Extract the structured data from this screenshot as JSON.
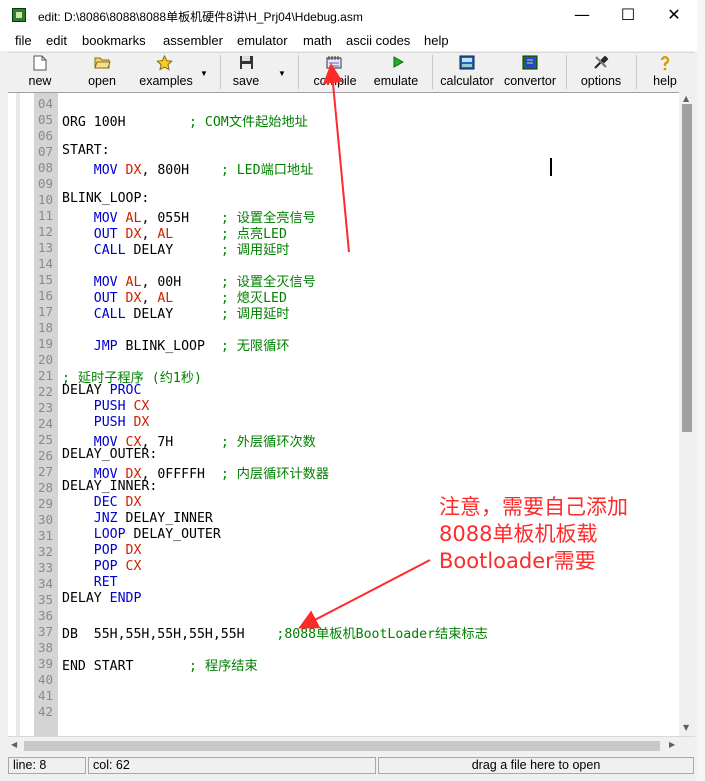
{
  "window": {
    "title": "edit: D:\\8086\\8088\\8088单板机硬件8讲\\H_Prj04\\Hdebug.asm",
    "controls": [
      "—",
      "☐",
      "✕"
    ]
  },
  "menu": [
    "file",
    "edit",
    "bookmarks",
    "assembler",
    "emulator",
    "math",
    "ascii codes",
    "help"
  ],
  "toolbar": {
    "new": "new",
    "open": "open",
    "examples": "examples",
    "save": "save",
    "compile": "compile",
    "emulate": "emulate",
    "calculator": "calculator",
    "convertor": "convertor",
    "options": "options",
    "help": "help"
  },
  "lines": [
    {
      "n": "04",
      "t": []
    },
    {
      "n": "05",
      "t": [
        [
          "ORG 100H        ",
          "p"
        ],
        [
          "; COM文件起始地址",
          "c"
        ]
      ]
    },
    {
      "n": "06",
      "t": []
    },
    {
      "n": "07",
      "t": [
        [
          "START:",
          "p"
        ]
      ]
    },
    {
      "n": "08",
      "t": [
        [
          "    ",
          "p"
        ],
        [
          "MOV",
          "k"
        ],
        [
          " ",
          "p"
        ],
        [
          "DX",
          "r"
        ],
        [
          ", 800H    ",
          "p"
        ],
        [
          "; LED端口地址",
          "c"
        ]
      ]
    },
    {
      "n": "09",
      "t": []
    },
    {
      "n": "10",
      "t": [
        [
          "BLINK_LOOP:",
          "p"
        ]
      ]
    },
    {
      "n": "11",
      "t": [
        [
          "    ",
          "p"
        ],
        [
          "MOV",
          "k"
        ],
        [
          " ",
          "p"
        ],
        [
          "AL",
          "r"
        ],
        [
          ", 055H    ",
          "p"
        ],
        [
          "; 设置全亮信号",
          "c"
        ]
      ]
    },
    {
      "n": "12",
      "t": [
        [
          "    ",
          "p"
        ],
        [
          "OUT",
          "k"
        ],
        [
          " ",
          "p"
        ],
        [
          "DX",
          "r"
        ],
        [
          ", ",
          "p"
        ],
        [
          "AL",
          "r"
        ],
        [
          "      ",
          "p"
        ],
        [
          "; 点亮LED",
          "c"
        ]
      ]
    },
    {
      "n": "13",
      "t": [
        [
          "    ",
          "p"
        ],
        [
          "CALL",
          "k"
        ],
        [
          " DELAY      ",
          "p"
        ],
        [
          "; 调用延时",
          "c"
        ]
      ]
    },
    {
      "n": "14",
      "t": []
    },
    {
      "n": "15",
      "t": [
        [
          "    ",
          "p"
        ],
        [
          "MOV",
          "k"
        ],
        [
          " ",
          "p"
        ],
        [
          "AL",
          "r"
        ],
        [
          ", 00H     ",
          "p"
        ],
        [
          "; 设置全灭信号",
          "c"
        ]
      ]
    },
    {
      "n": "16",
      "t": [
        [
          "    ",
          "p"
        ],
        [
          "OUT",
          "k"
        ],
        [
          " ",
          "p"
        ],
        [
          "DX",
          "r"
        ],
        [
          ", ",
          "p"
        ],
        [
          "AL",
          "r"
        ],
        [
          "      ",
          "p"
        ],
        [
          "; 熄灭LED",
          "c"
        ]
      ]
    },
    {
      "n": "17",
      "t": [
        [
          "    ",
          "p"
        ],
        [
          "CALL",
          "k"
        ],
        [
          " DELAY      ",
          "p"
        ],
        [
          "; 调用延时",
          "c"
        ]
      ]
    },
    {
      "n": "18",
      "t": []
    },
    {
      "n": "19",
      "t": [
        [
          "    ",
          "p"
        ],
        [
          "JMP",
          "k"
        ],
        [
          " BLINK_LOOP  ",
          "p"
        ],
        [
          "; 无限循环",
          "c"
        ]
      ]
    },
    {
      "n": "20",
      "t": []
    },
    {
      "n": "21",
      "t": [
        [
          "; 延时子程序 (约1秒)",
          "c"
        ]
      ]
    },
    {
      "n": "22",
      "t": [
        [
          "DELAY ",
          "p"
        ],
        [
          "PROC",
          "k"
        ]
      ]
    },
    {
      "n": "23",
      "t": [
        [
          "    ",
          "p"
        ],
        [
          "PUSH",
          "k"
        ],
        [
          " ",
          "p"
        ],
        [
          "CX",
          "r"
        ]
      ]
    },
    {
      "n": "24",
      "t": [
        [
          "    ",
          "p"
        ],
        [
          "PUSH",
          "k"
        ],
        [
          " ",
          "p"
        ],
        [
          "DX",
          "r"
        ]
      ]
    },
    {
      "n": "25",
      "t": [
        [
          "    ",
          "p"
        ],
        [
          "MOV",
          "k"
        ],
        [
          " ",
          "p"
        ],
        [
          "CX",
          "r"
        ],
        [
          ", 7H      ",
          "p"
        ],
        [
          "; 外层循环次数",
          "c"
        ]
      ]
    },
    {
      "n": "26",
      "t": [
        [
          "DELAY_OUTER:",
          "p"
        ]
      ]
    },
    {
      "n": "27",
      "t": [
        [
          "    ",
          "p"
        ],
        [
          "MOV",
          "k"
        ],
        [
          " ",
          "p"
        ],
        [
          "DX",
          "r"
        ],
        [
          ", 0FFFFH  ",
          "p"
        ],
        [
          "; 内层循环计数器",
          "c"
        ]
      ]
    },
    {
      "n": "28",
      "t": [
        [
          "DELAY_INNER:",
          "p"
        ]
      ]
    },
    {
      "n": "29",
      "t": [
        [
          "    ",
          "p"
        ],
        [
          "DEC",
          "k"
        ],
        [
          " ",
          "p"
        ],
        [
          "DX",
          "r"
        ]
      ]
    },
    {
      "n": "30",
      "t": [
        [
          "    ",
          "p"
        ],
        [
          "JNZ",
          "k"
        ],
        [
          " DELAY_INNER",
          "p"
        ]
      ]
    },
    {
      "n": "31",
      "t": [
        [
          "    ",
          "p"
        ],
        [
          "LOOP",
          "k"
        ],
        [
          " DELAY_OUTER",
          "p"
        ]
      ]
    },
    {
      "n": "32",
      "t": [
        [
          "    ",
          "p"
        ],
        [
          "POP",
          "k"
        ],
        [
          " ",
          "p"
        ],
        [
          "DX",
          "r"
        ]
      ]
    },
    {
      "n": "33",
      "t": [
        [
          "    ",
          "p"
        ],
        [
          "POP",
          "k"
        ],
        [
          " ",
          "p"
        ],
        [
          "CX",
          "r"
        ]
      ]
    },
    {
      "n": "34",
      "t": [
        [
          "    ",
          "p"
        ],
        [
          "RET",
          "k"
        ]
      ]
    },
    {
      "n": "35",
      "t": [
        [
          "DELAY ",
          "p"
        ],
        [
          "ENDP",
          "k"
        ]
      ]
    },
    {
      "n": "36",
      "t": []
    },
    {
      "n": "37",
      "t": [
        [
          "DB  55H,55H,55H,55H,55H    ",
          "p"
        ],
        [
          ";8088单板机BootLoader结束标志",
          "c"
        ]
      ]
    },
    {
      "n": "38",
      "t": []
    },
    {
      "n": "39",
      "t": [
        [
          "END START       ",
          "p"
        ],
        [
          "; 程序结束",
          "c"
        ]
      ]
    },
    {
      "n": "40",
      "t": []
    },
    {
      "n": "41",
      "t": []
    },
    {
      "n": "42",
      "t": []
    }
  ],
  "annotation": [
    "注意，需要自己添加",
    "8088单板机板载",
    "Bootloader需要"
  ],
  "status": {
    "line": "line: 8",
    "col": "col: 62",
    "drag": "drag a file here to open"
  },
  "colors": {
    "keyword": "#0000cc",
    "register": "#cc2200",
    "comment": "#008000",
    "annotation": "#ff2a2a"
  }
}
